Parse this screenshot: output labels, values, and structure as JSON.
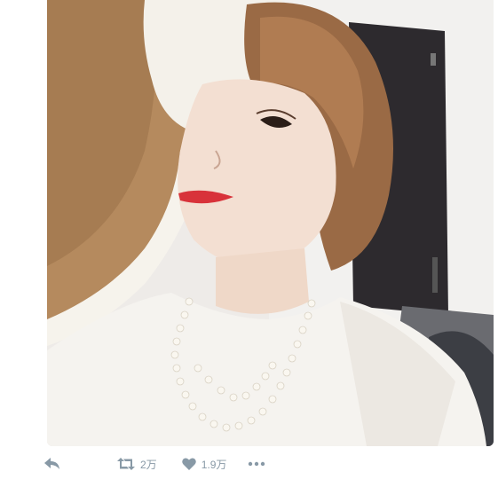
{
  "photo": {
    "subject": "portrait-photo"
  },
  "actions": {
    "reply_icon": "reply-icon",
    "retweet_icon": "retweet-icon",
    "retweet_count": "2万",
    "like_icon": "heart-icon",
    "like_count": "1.9万",
    "more_icon": "more-dots-icon"
  },
  "colors": {
    "action_gray": "#8899a6",
    "background": "#ffffff"
  }
}
